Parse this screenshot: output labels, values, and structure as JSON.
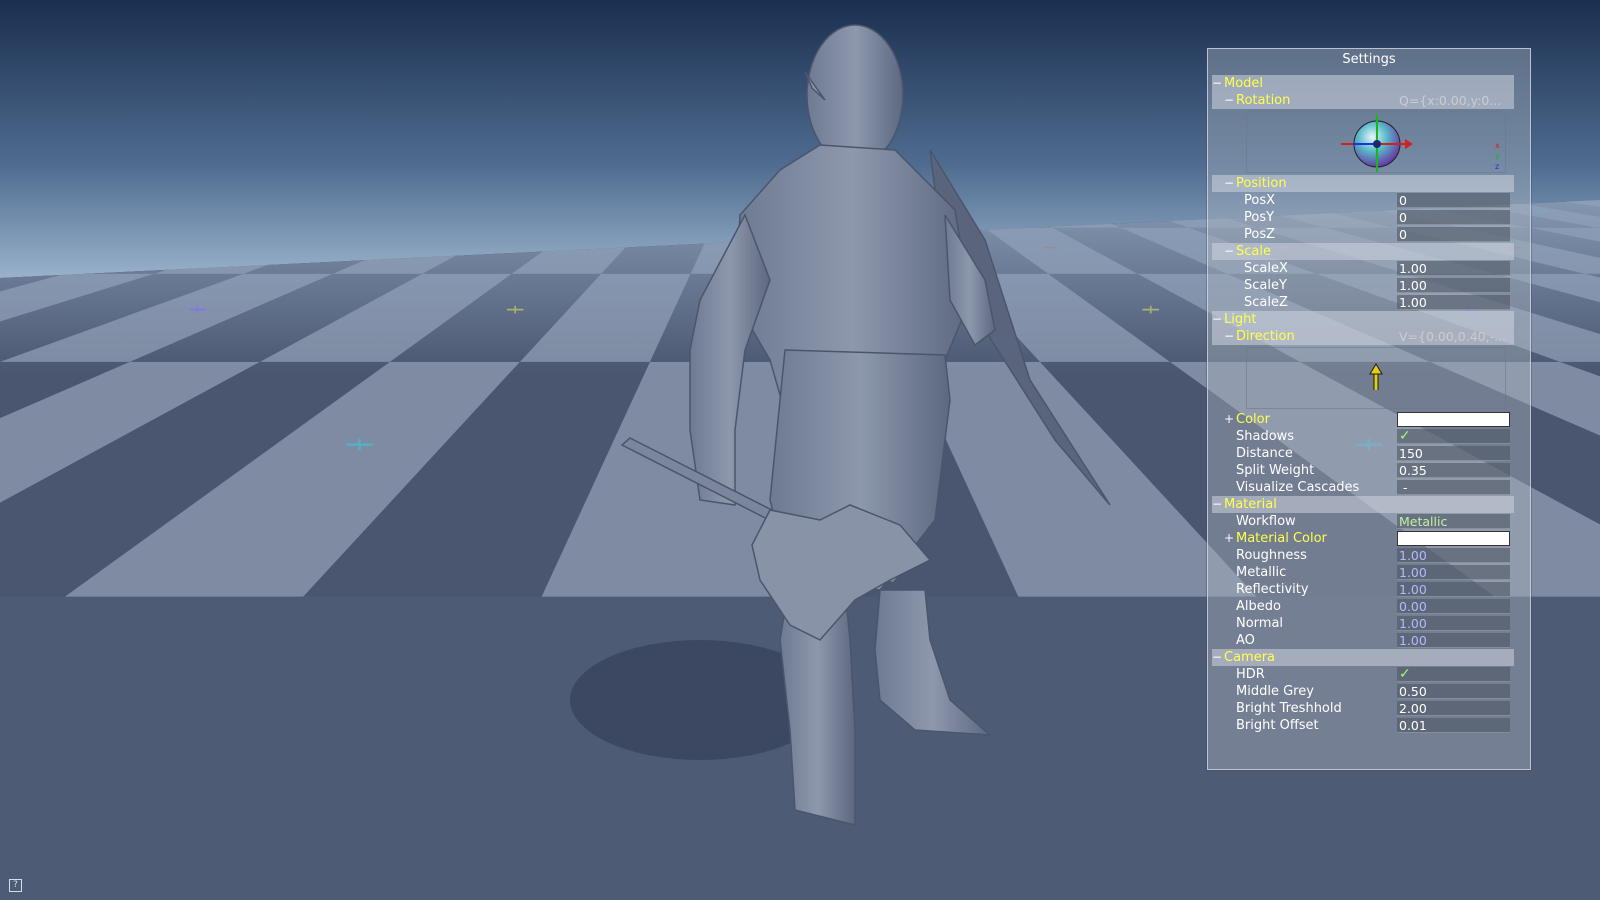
{
  "colors": {
    "sky_top": "#1c3050",
    "sky_horizon": "#a9bfd6",
    "floor_light": "#7e8ba2",
    "floor_dark": "#4a5670",
    "label_gold": "#ffff4a",
    "value_blue": "#b6b8ff",
    "value_green": "#c0f0a6"
  },
  "settings": {
    "title": "Settings",
    "model": {
      "label": "Model",
      "toggle": "−",
      "rotation": {
        "label": "Rotation",
        "toggle": "−",
        "value": "Q={x:0.00,y:0...",
        "axes": [
          "x",
          "y",
          "z"
        ]
      },
      "position": {
        "label": "Position",
        "toggle": "−",
        "fields": [
          {
            "label": "PosX",
            "value": "0"
          },
          {
            "label": "PosY",
            "value": "0"
          },
          {
            "label": "PosZ",
            "value": "0"
          }
        ]
      },
      "scale": {
        "label": "Scale",
        "toggle": "−",
        "fields": [
          {
            "label": "ScaleX",
            "value": "1.00"
          },
          {
            "label": "ScaleY",
            "value": "1.00"
          },
          {
            "label": "ScaleZ",
            "value": "1.00"
          }
        ]
      }
    },
    "light": {
      "label": "Light",
      "toggle": "−",
      "direction": {
        "label": "Direction",
        "toggle": "−",
        "value": "V={0.00,0.40,-..."
      },
      "color": {
        "label": "Color",
        "toggle": "+"
      },
      "shadows": {
        "label": "Shadows",
        "value": "✓"
      },
      "distance": {
        "label": "Distance",
        "value": "150"
      },
      "split_weight": {
        "label": "Split Weight",
        "value": "0.35"
      },
      "visualize_cascades": {
        "label": "Visualize Cascades",
        "value": "-"
      }
    },
    "material": {
      "label": "Material",
      "toggle": "−",
      "workflow": {
        "label": "Workflow",
        "value": "Metallic"
      },
      "material_color": {
        "label": "Material Color",
        "toggle": "+"
      },
      "fields": [
        {
          "label": "Roughness",
          "value": "1.00"
        },
        {
          "label": "Metallic",
          "value": "1.00"
        },
        {
          "label": "Reflectivity",
          "value": "1.00"
        },
        {
          "label": "Albedo",
          "value": "0.00"
        },
        {
          "label": "Normal",
          "value": "1.00"
        },
        {
          "label": "AO",
          "value": "1.00"
        }
      ]
    },
    "camera": {
      "label": "Camera",
      "toggle": "−",
      "hdr": {
        "label": "HDR",
        "value": "✓"
      },
      "middle_grey": {
        "label": "Middle Grey",
        "value": "0.50"
      },
      "bright_threshold": {
        "label": "Bright Treshhold",
        "value": "2.00"
      },
      "bright_offset": {
        "label": "Bright Offset",
        "value": "0.01"
      }
    }
  },
  "help_icon": "?"
}
